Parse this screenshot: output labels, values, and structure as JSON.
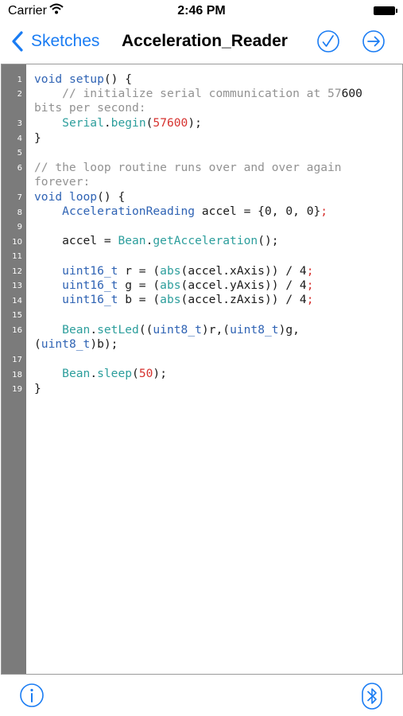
{
  "status_bar": {
    "carrier": "Carrier",
    "time": "2:46 PM"
  },
  "nav": {
    "back_label": "Sketches",
    "title": "Acceleration_Reader"
  },
  "editor": {
    "line_numbers": [
      "1",
      "2",
      "3",
      "4",
      "5",
      "6",
      "7",
      "8",
      "9",
      "10",
      "11",
      "12",
      "13",
      "14",
      "15",
      "16",
      "17",
      "18",
      "19"
    ],
    "code_lines": [
      "void setup() {",
      "    // initialize serial communication at 57600",
      "bits per second:",
      "    Serial.begin(57600);",
      "}",
      "// the loop routine runs over and over again",
      "forever:",
      "void loop() {",
      "    AccelerationReading accel = {0, 0, 0};",
      "    accel = Bean.getAcceleration();",
      "    uint16_t r = (abs(accel.xAxis)) / 4;",
      "    uint16_t g = (abs(accel.yAxis)) / 4;",
      "    uint16_t b = (abs(accel.zAxis)) / 4;",
      "    Bean.setLed((uint8_t)r,(uint8_t)g,",
      "(uint8_t)b);",
      "    Bean.sleep(50);",
      "}"
    ]
  },
  "colors": {
    "accent": "#1a7cf3",
    "gutter": "#7b7b7b",
    "keyword": "#2f63b4",
    "function": "#2c9e9c",
    "number": "#d6322f",
    "comment": "#929292"
  },
  "icons": [
    "wifi-icon",
    "battery-icon",
    "chevron-left-icon",
    "checkmark-circle-icon",
    "arrow-right-circle-icon",
    "info-circle-icon",
    "bluetooth-icon"
  ]
}
